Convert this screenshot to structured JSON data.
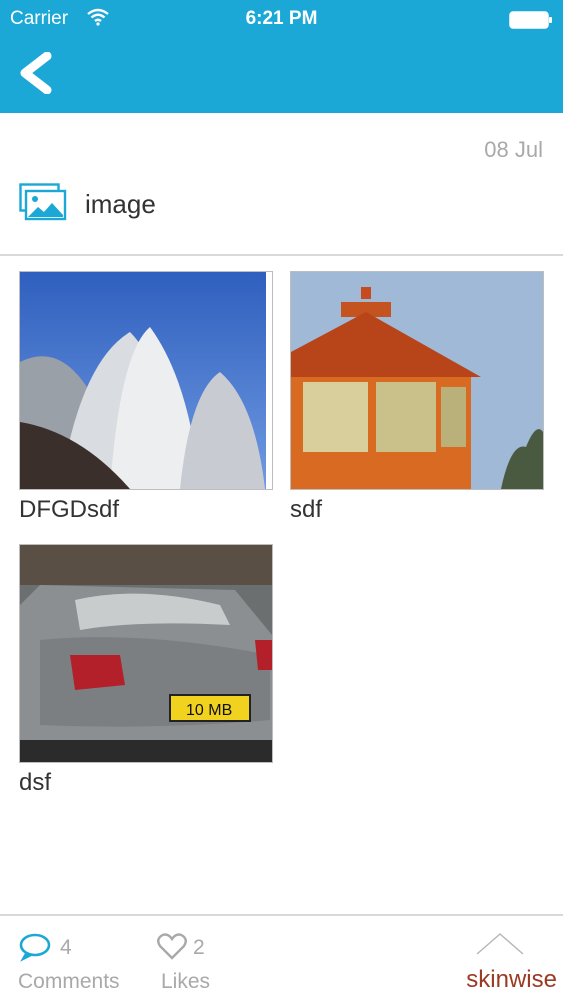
{
  "status_bar": {
    "carrier": "Carrier",
    "time": "6:21 PM"
  },
  "nav": {
    "back_icon": "chevron-left-icon",
    "bar_color": "#1ba8d6"
  },
  "post": {
    "date": "08 Jul",
    "type_icon": "image-icon",
    "type_label": "image"
  },
  "gallery": {
    "items": [
      {
        "caption": "DFGDsdf",
        "photo": "lotus-temple-photo"
      },
      {
        "caption": "sdf",
        "photo": "lighthouse-cupola-photo"
      },
      {
        "caption": "dsf",
        "photo": "grey-car-rear-photo"
      }
    ]
  },
  "footer": {
    "comments_count": "4",
    "comments_label": "Comments",
    "likes_count": "2",
    "likes_label": "Likes",
    "brand_label": "skinwise",
    "accent_color": "#1ba8d6",
    "brand_color": "#9b3a22"
  }
}
